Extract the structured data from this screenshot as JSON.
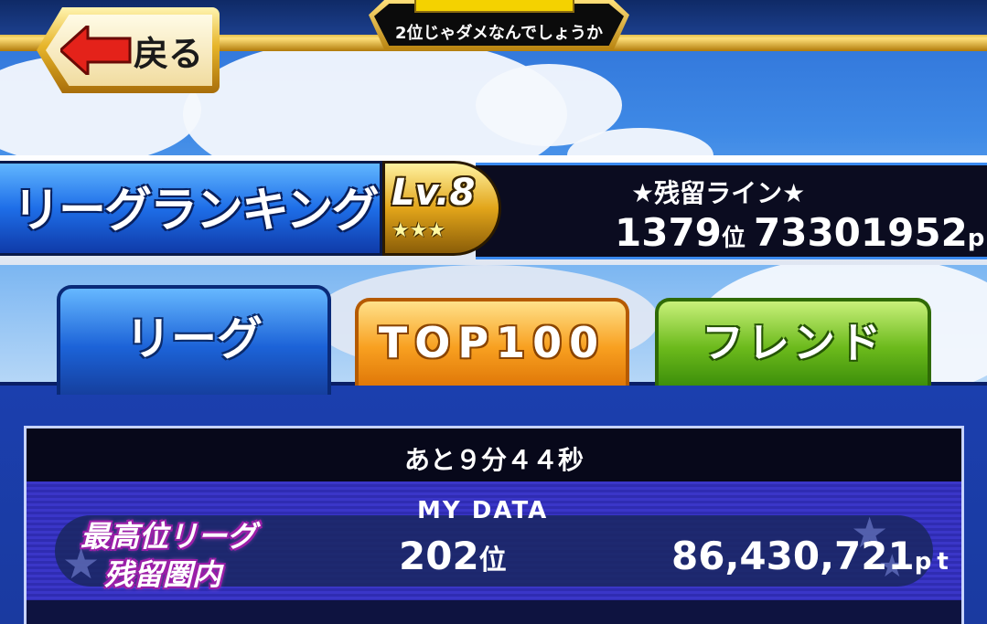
{
  "top": {
    "message": "2位じゃダメなんでしょうか",
    "progress_fraction": 1.0
  },
  "back_button": {
    "label": "戻る"
  },
  "header": {
    "title": "リーグランキング",
    "level": "Lv.8",
    "stars": "★★★",
    "zanryu_title": "★残留ライン★",
    "zanryu_rank": "1379",
    "zanryu_rank_unit": "位",
    "zanryu_points": "73301952",
    "zanryu_points_unit": "pt"
  },
  "tabs": [
    {
      "label": "リーグ",
      "active": true
    },
    {
      "label": "TOP100",
      "active": false
    },
    {
      "label": "フレンド",
      "active": false
    }
  ],
  "panel": {
    "timer": "あと９分４４秒",
    "mydata_label": "MY DATA",
    "badge_line1": "最高位リーグ",
    "badge_line2": "残留圏内",
    "my_rank": "202",
    "my_rank_unit": "位",
    "my_points": "86,430,721",
    "my_points_unit": "pt"
  },
  "colors": {
    "league_tab": "#1c63d8",
    "top100_tab": "#f8a020",
    "friend_tab": "#6cba1c",
    "badge_glow": "#9b1ea8"
  }
}
